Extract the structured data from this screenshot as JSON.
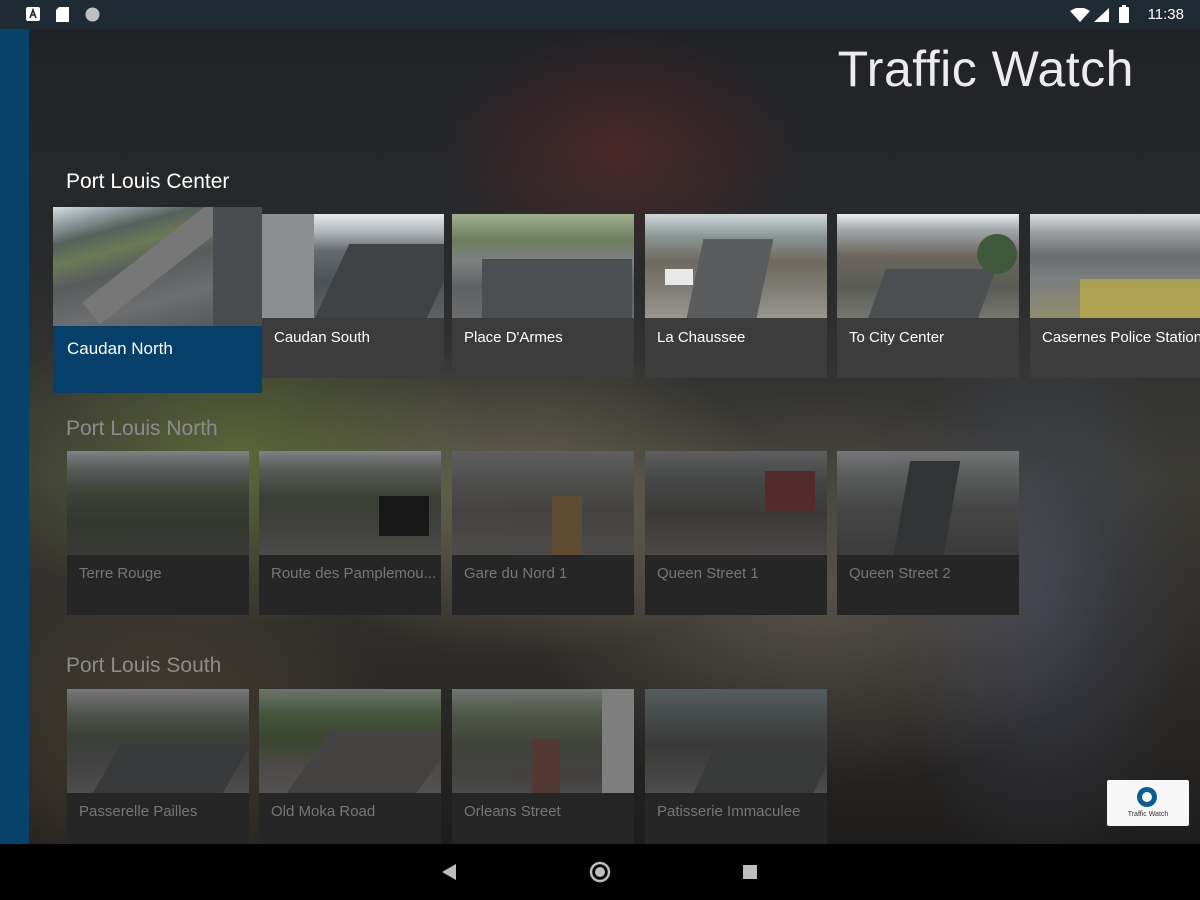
{
  "status_bar": {
    "time": "11:38",
    "left_icons": [
      "a-box-icon",
      "sd-card-icon",
      "circle-icon"
    ],
    "right_icons": [
      "wifi-icon",
      "signal-icon",
      "battery-icon"
    ]
  },
  "app": {
    "title": "Traffic Watch"
  },
  "sections": [
    {
      "title": "Port Louis Center",
      "cameras": [
        "Caudan North",
        "Caudan South",
        "Place D'Armes",
        "La Chaussee",
        "To City Center",
        "Casernes Police Station"
      ]
    },
    {
      "title": "Port Louis North",
      "cameras": [
        "Terre Rouge",
        "Route des Pamplemou...",
        "Gare du Nord 1",
        "Queen Street 1",
        "Queen Street 2"
      ]
    },
    {
      "title": "Port Louis South",
      "cameras": [
        "Passerelle Pailles",
        "Old Moka Road",
        "Orleans Street",
        "Patisserie Immaculee"
      ]
    }
  ],
  "selected_camera": "Caudan North",
  "ad": {
    "label": "Traffic Watch"
  },
  "nav": {
    "items": [
      "back-icon",
      "home-icon",
      "recents-icon"
    ]
  },
  "colors": {
    "accent": "#063f69",
    "side_bar": "#07426a",
    "status_bar": "#1e2b33",
    "tile": "#3c3c3c",
    "tile_dim": "#262626"
  }
}
